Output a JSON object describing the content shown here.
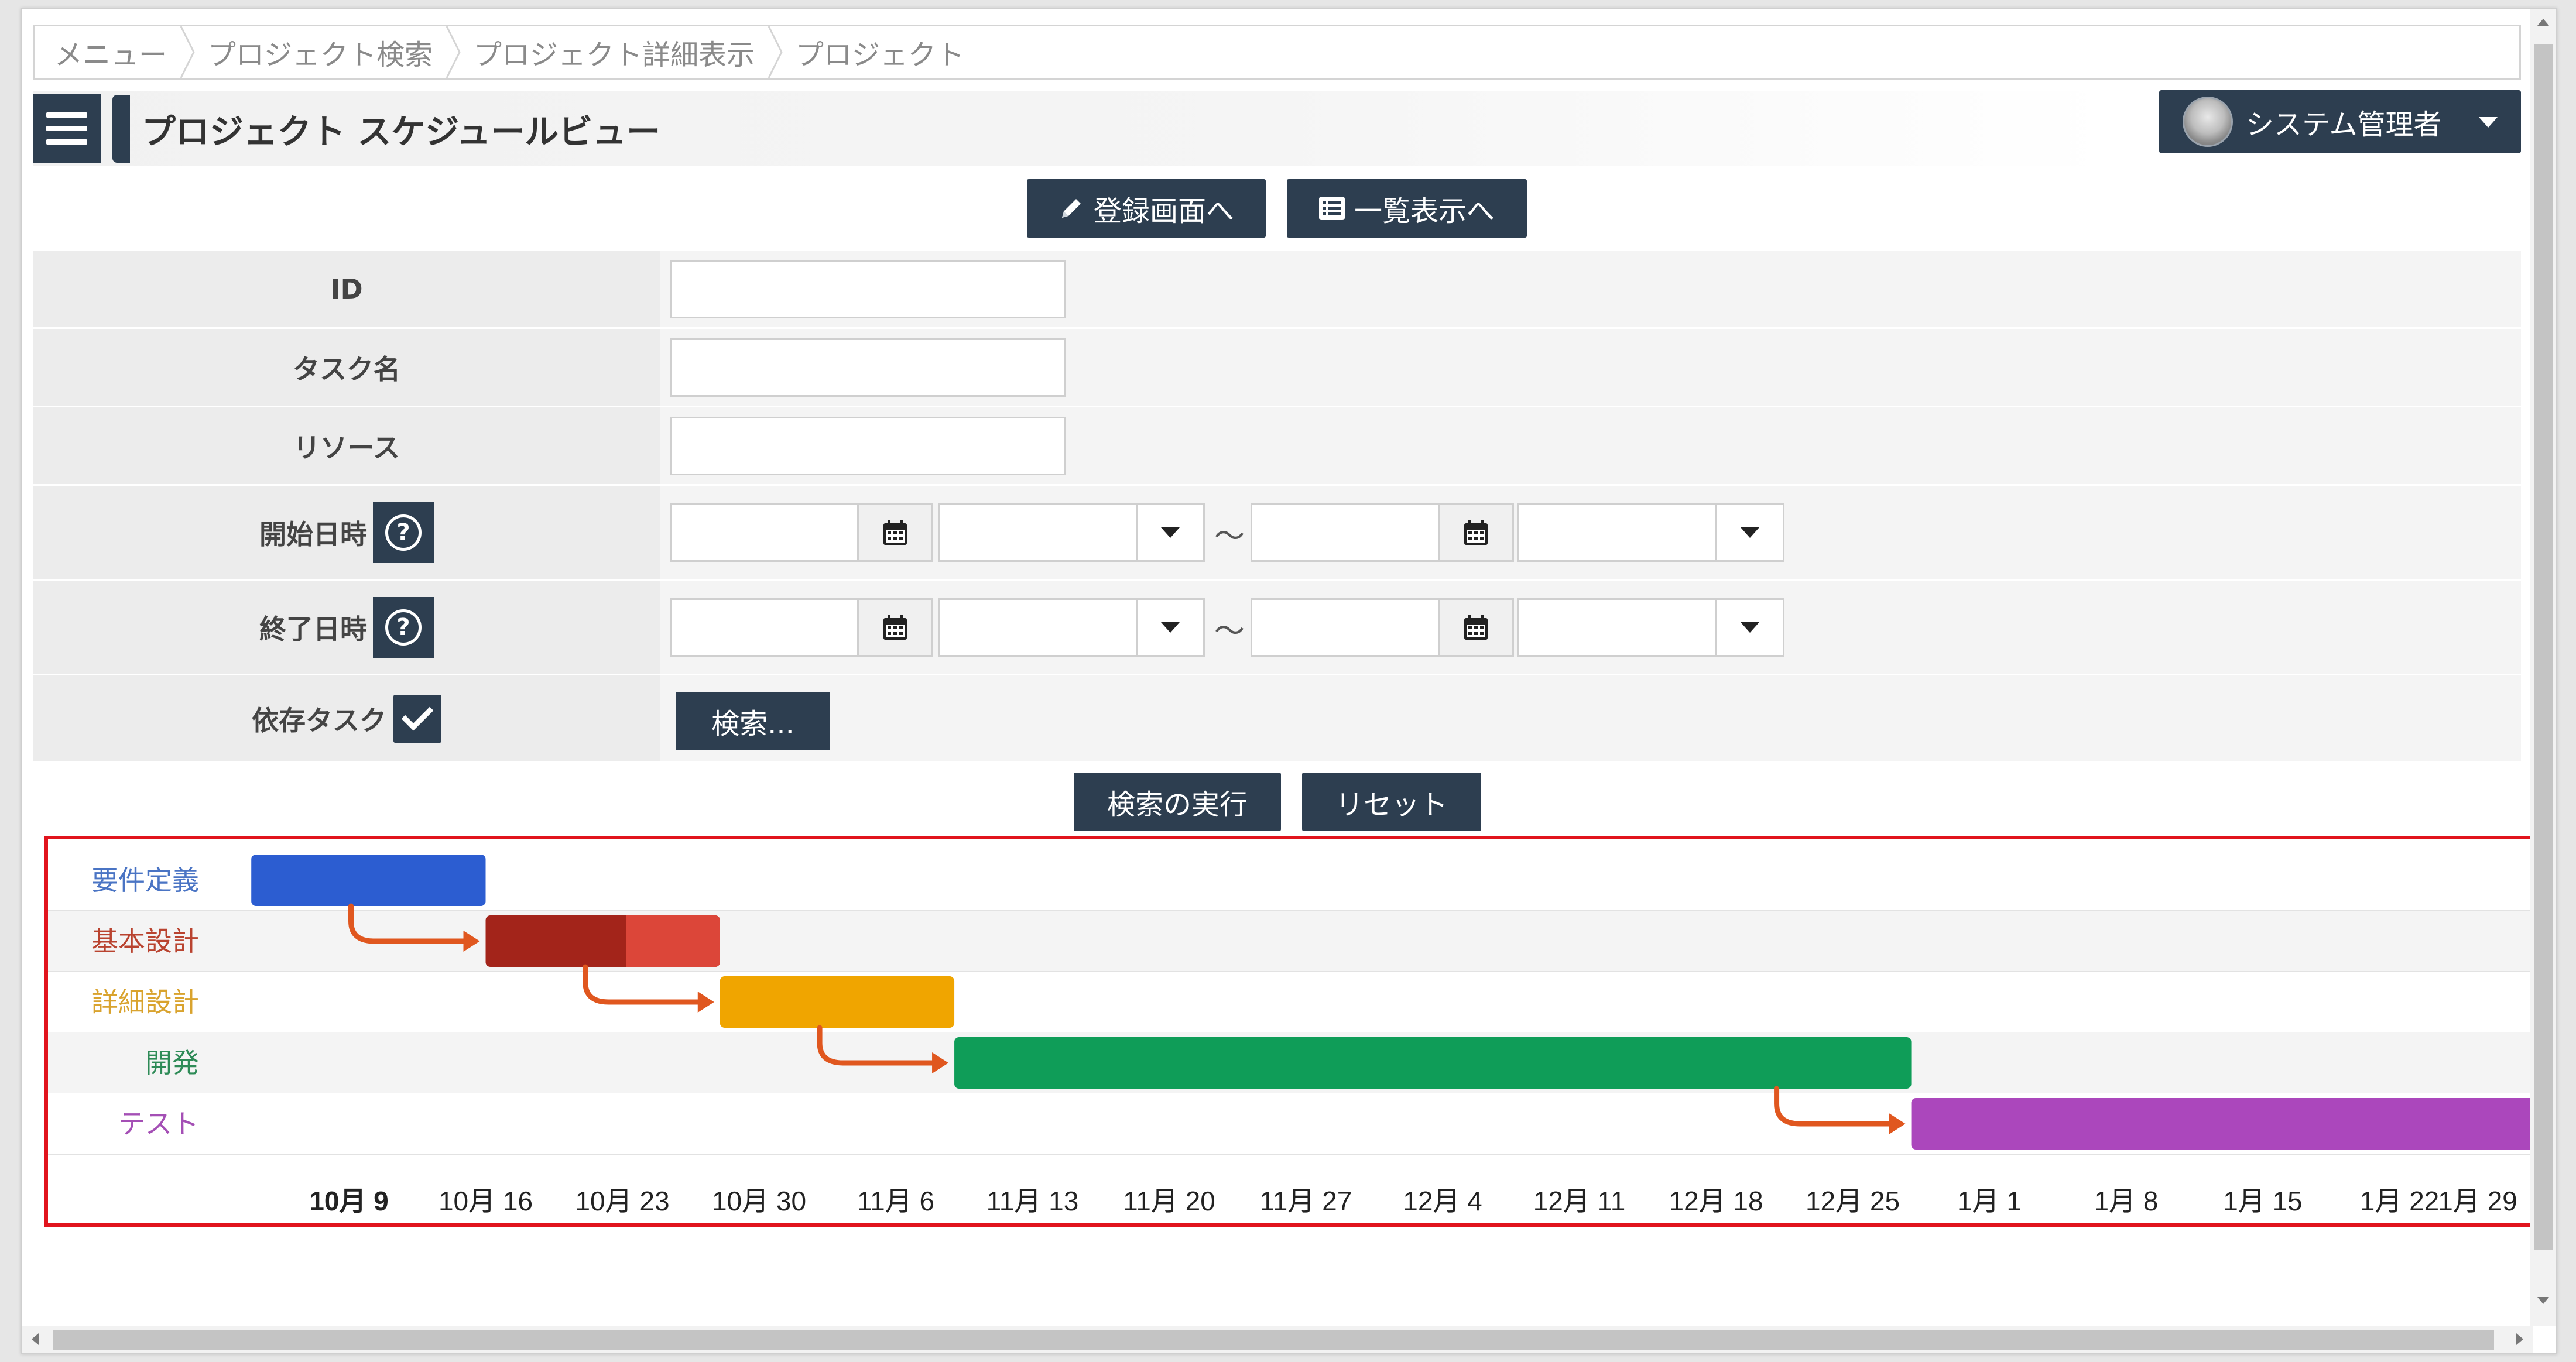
{
  "breadcrumb": [
    "メニュー",
    "プロジェクト検索",
    "プロジェクト詳細表示",
    "プロジェクト"
  ],
  "header": {
    "title": "プロジェクト スケジュールビュー",
    "user": "システム管理者"
  },
  "actions": {
    "register": "登録画面へ",
    "list": "一覧表示へ"
  },
  "form": {
    "id_label": "ID",
    "task_label": "タスク名",
    "resource_label": "リソース",
    "start_label": "開始日時",
    "end_label": "終了日時",
    "depend_label": "依存タスク",
    "help_glyph": "?",
    "range_sep": "～",
    "depend_search": "検索...",
    "id_value": "",
    "task_value": "",
    "resource_value": ""
  },
  "search": {
    "execute": "検索の実行",
    "reset": "リセット"
  },
  "colors": {
    "primary": "#2d3e50",
    "highlight": "#e1141d",
    "arrow": "#e0571f"
  },
  "chart_data": {
    "type": "gantt",
    "tasks": [
      {
        "name": "要件定義",
        "start": "10月 4",
        "end": "10月 16",
        "color": "#2c5dd1",
        "label_color": "#4a74c4"
      },
      {
        "name": "基本設計",
        "start": "10月 16",
        "end": "10月 28",
        "color": "#a3241a",
        "progress_color": "#dc4639",
        "progress": 0.6,
        "label_color": "#b9432f"
      },
      {
        "name": "詳細設計",
        "start": "10月 28",
        "end": "11月 9",
        "color": "#f0a500",
        "label_color": "#d9a32e"
      },
      {
        "name": "開発",
        "start": "11月 9",
        "end": "12月 28",
        "color": "#0f9d58",
        "label_color": "#2e8b57"
      },
      {
        "name": "テスト",
        "start": "12月 28",
        "end": "1月 31",
        "color": "#ab47bc",
        "label_color": "#a44fb5"
      }
    ],
    "dependencies": [
      [
        "要件定義",
        "基本設計"
      ],
      [
        "基本設計",
        "詳細設計"
      ],
      [
        "詳細設計",
        "開発"
      ],
      [
        "開発",
        "テスト"
      ]
    ],
    "x_ticks": [
      "10月 9",
      "10月 16",
      "10月 23",
      "10月 30",
      "11月 6",
      "11月 13",
      "11月 20",
      "11月 27",
      "12月 4",
      "12月 11",
      "12月 18",
      "12月 25",
      "1月 1",
      "1月 8",
      "1月 15",
      "1月 22",
      "1月 29"
    ],
    "bold_tick": "10月 9"
  }
}
